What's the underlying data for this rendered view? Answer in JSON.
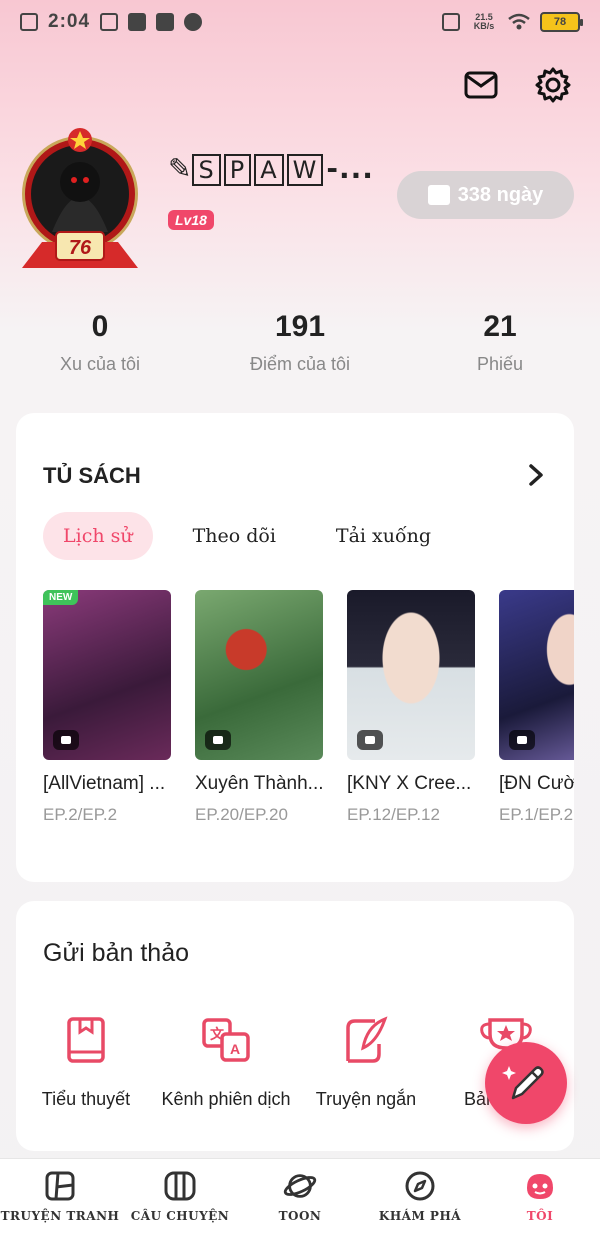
{
  "status_bar": {
    "time": "2:04",
    "net_speed": "21.5 KB/s",
    "battery": "78"
  },
  "profile": {
    "username_prefix": "✎",
    "username_letters": [
      "S",
      "P",
      "A",
      "W"
    ],
    "username_suffix": "-...",
    "level": "Lv18",
    "avatar_badge": "76",
    "days": "338 ngày"
  },
  "stats": [
    {
      "value": "0",
      "label": "Xu của tôi"
    },
    {
      "value": "191",
      "label": "Điểm của tôi"
    },
    {
      "value": "21",
      "label": "Phiếu"
    }
  ],
  "shelf": {
    "title": "TỦ SÁCH",
    "tabs": [
      "Lịch sử",
      "Theo dõi",
      "Tải xuống"
    ],
    "active_tab": "Lịch sử",
    "new_badge": "NEW",
    "books": [
      {
        "title": "[AllVietnam] ...",
        "episode": "EP.2/EP.2",
        "cover_color": "#5b2a4a"
      },
      {
        "title": "Xuyên Thành...",
        "episode": "EP.20/EP.20",
        "cover_color": "#4a6b3a"
      },
      {
        "title": "[KNY X Cree...",
        "episode": "EP.12/EP.12",
        "cover_color": "#c9d3d8"
      },
      {
        "title": "[ĐN Cười",
        "episode": "EP.1/EP.2",
        "cover_color": "#2a2a5a"
      }
    ]
  },
  "submit": {
    "title": "Gửi bản thảo",
    "items": [
      {
        "label": "Tiểu thuyết",
        "icon": "book-icon"
      },
      {
        "label": "Kênh phiên dịch",
        "icon": "translate-icon"
      },
      {
        "label": "Truyện ngắn",
        "icon": "quill-icon"
      },
      {
        "label": "Bảng X...g",
        "icon": "trophy-icon"
      }
    ]
  },
  "bottom_nav": [
    {
      "label": "TRUYỆN TRANH",
      "icon": "comic-icon"
    },
    {
      "label": "CÂU CHUYỆN",
      "icon": "story-icon"
    },
    {
      "label": "TOON",
      "icon": "planet-icon"
    },
    {
      "label": "KHÁM PHÁ",
      "icon": "compass-icon"
    },
    {
      "label": "TÔI",
      "icon": "me-icon"
    }
  ],
  "colors": {
    "accent": "#f0476a",
    "accent_soft": "#fde3e8"
  }
}
